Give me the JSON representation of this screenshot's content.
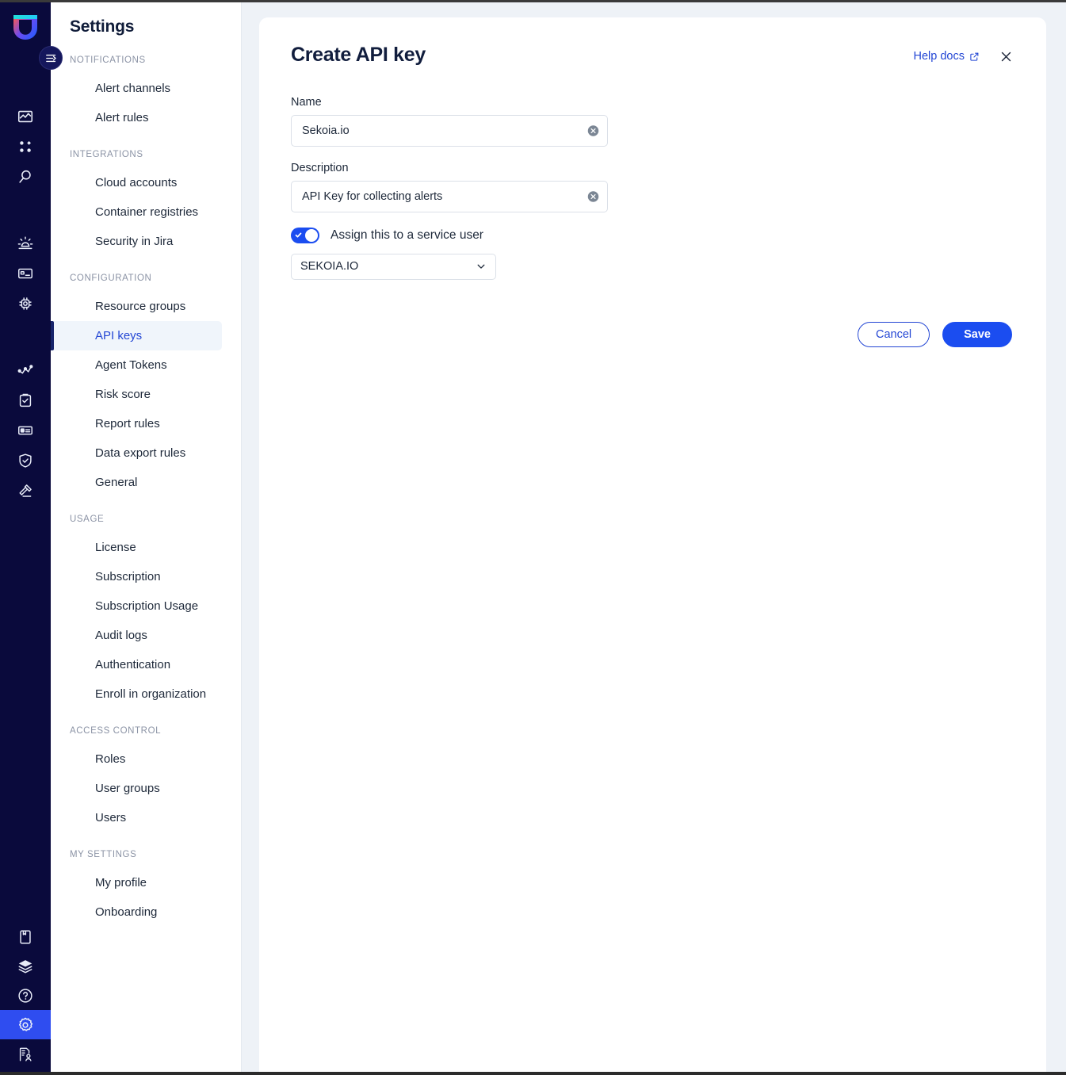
{
  "rail": {
    "logo_name": "unified-shield-logo",
    "toggle_label": "Collapse navigation",
    "items_top": [
      {
        "name": "dashboard-chart-icon",
        "label": "Dashboard"
      },
      {
        "name": "apps-grid-icon",
        "label": "Applications"
      },
      {
        "name": "search-icon",
        "label": "Search"
      }
    ],
    "items_mid": [
      {
        "name": "alert-beacon-icon",
        "label": "Alerts"
      },
      {
        "name": "inventory-card-icon",
        "label": "Inventory"
      },
      {
        "name": "workloads-chip-icon",
        "label": "Workloads"
      }
    ],
    "items_low": [
      {
        "name": "network-graph-icon",
        "label": "Network"
      },
      {
        "name": "tasks-clipboard-icon",
        "label": "Tasks"
      },
      {
        "name": "reports-id-icon",
        "label": "Reports"
      },
      {
        "name": "shield-check-icon",
        "label": "Compliance"
      },
      {
        "name": "gavel-icon",
        "label": "Governance"
      }
    ],
    "items_bottom": [
      {
        "name": "book-icon",
        "label": "Documentation"
      },
      {
        "name": "layers-icon",
        "label": "Layers"
      },
      {
        "name": "help-circle-icon",
        "label": "Help"
      },
      {
        "name": "gear-icon",
        "label": "Settings",
        "active": true
      },
      {
        "name": "user-admin-icon",
        "label": "Administration"
      }
    ]
  },
  "sidebar": {
    "title": "Settings",
    "sections": [
      {
        "label": "NOTIFICATIONS",
        "items": [
          {
            "label": "Alert channels",
            "key": "alert-channels"
          },
          {
            "label": "Alert rules",
            "key": "alert-rules"
          }
        ]
      },
      {
        "label": "INTEGRATIONS",
        "items": [
          {
            "label": "Cloud accounts",
            "key": "cloud-accounts"
          },
          {
            "label": "Container registries",
            "key": "container-registries"
          },
          {
            "label": "Security in Jira",
            "key": "security-in-jira"
          }
        ]
      },
      {
        "label": "CONFIGURATION",
        "items": [
          {
            "label": "Resource groups",
            "key": "resource-groups"
          },
          {
            "label": "API keys",
            "key": "api-keys",
            "active": true
          },
          {
            "label": "Agent Tokens",
            "key": "agent-tokens"
          },
          {
            "label": "Risk score",
            "key": "risk-score"
          },
          {
            "label": "Report rules",
            "key": "report-rules"
          },
          {
            "label": "Data export rules",
            "key": "data-export-rules"
          },
          {
            "label": "General",
            "key": "general"
          }
        ]
      },
      {
        "label": "USAGE",
        "items": [
          {
            "label": "License",
            "key": "license"
          },
          {
            "label": "Subscription",
            "key": "subscription"
          },
          {
            "label": "Subscription Usage",
            "key": "subscription-usage"
          },
          {
            "label": "Audit logs",
            "key": "audit-logs"
          },
          {
            "label": "Authentication",
            "key": "authentication"
          },
          {
            "label": "Enroll in organization",
            "key": "enroll-in-organization"
          }
        ]
      },
      {
        "label": "ACCESS CONTROL",
        "items": [
          {
            "label": "Roles",
            "key": "roles"
          },
          {
            "label": "User groups",
            "key": "user-groups"
          },
          {
            "label": "Users",
            "key": "users"
          }
        ]
      },
      {
        "label": "MY SETTINGS",
        "items": [
          {
            "label": "My profile",
            "key": "my-profile"
          },
          {
            "label": "Onboarding",
            "key": "onboarding"
          }
        ]
      }
    ]
  },
  "panel": {
    "title": "Create API key",
    "help_docs_label": "Help docs",
    "help_docs_icon": "external-link-icon",
    "close_icon": "close-icon"
  },
  "form": {
    "name": {
      "label": "Name",
      "value": "Sekoia.io",
      "placeholder": "Name",
      "clear_icon": "clear-circle-icon"
    },
    "description": {
      "label": "Description",
      "value": "API Key for collecting alerts",
      "placeholder": "Description",
      "clear_icon": "clear-circle-icon"
    },
    "service_user_toggle": {
      "label": "Assign this to a service user",
      "checked": true
    },
    "service_user_select": {
      "value": "SEKOIA.IO",
      "chevron_icon": "chevron-down-icon"
    },
    "cancel_label": "Cancel",
    "save_label": "Save"
  },
  "colors": {
    "rail_bg": "#0a0a3c",
    "accent_blue": "#1b4df0",
    "link_blue": "#2346d4",
    "active_nav_bg": "#f0f5fb",
    "active_nav_bar": "#17246b",
    "page_bg": "#eef2f7"
  }
}
